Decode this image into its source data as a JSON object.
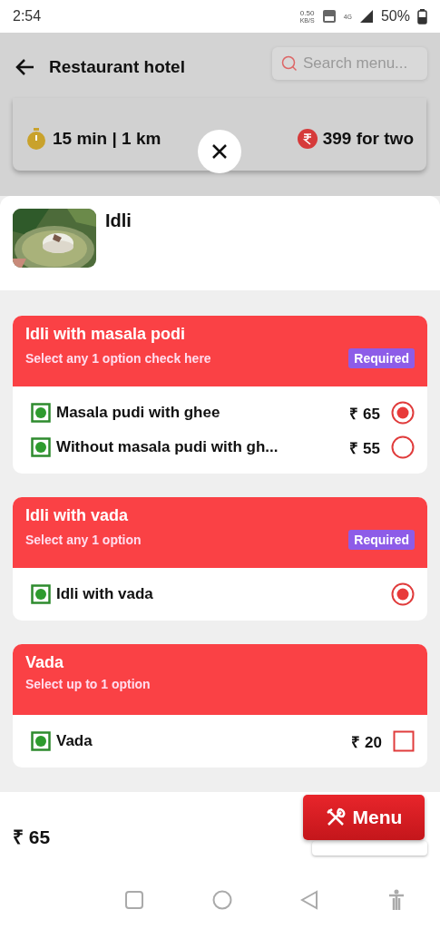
{
  "status_bar": {
    "time": "2:54",
    "speed": "0.50",
    "speed_unit": "KB/S",
    "network": "4G",
    "battery": "50%"
  },
  "header": {
    "title": "Restaurant hotel",
    "search": {
      "placeholder": "Search menu..."
    }
  },
  "info_card": {
    "time_distance": "15 min | 1 km",
    "cost": "399 for two"
  },
  "item": {
    "name": "Idli"
  },
  "groups": [
    {
      "title": "Idli with masala podi",
      "subtitle": "Select any 1 option check here",
      "badge": "Required",
      "options": [
        {
          "kind": "radio",
          "name": "Masala pudi with ghee",
          "price": "₹ 65",
          "selected": true
        },
        {
          "kind": "radio",
          "name": "Without masala pudi with gh...",
          "price": "₹ 55",
          "selected": false
        }
      ]
    },
    {
      "title": "Idli with vada",
      "subtitle": "Select any 1 option",
      "badge": "Required",
      "options": [
        {
          "kind": "radio",
          "name": "Idli with vada",
          "selected": true
        }
      ]
    },
    {
      "title": "Vada",
      "subtitle": "Select up to 1 option",
      "options": [
        {
          "kind": "checkbox",
          "name": "Vada",
          "price": "₹ 20",
          "checked": false
        }
      ]
    }
  ],
  "footer": {
    "total": "₹ 65",
    "menu_button": "Menu"
  }
}
